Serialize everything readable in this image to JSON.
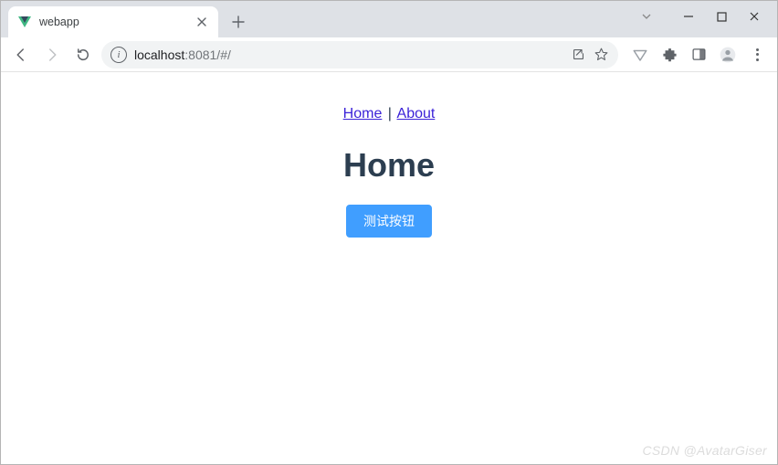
{
  "tab": {
    "title": "webapp"
  },
  "address": {
    "host": "localhost",
    "rest": ":8081/#/"
  },
  "nav": {
    "home": "Home",
    "sep": "|",
    "about": "About"
  },
  "page": {
    "heading": "Home"
  },
  "button": {
    "label": "测试按钮"
  },
  "watermark": "CSDN @AvatarGiser"
}
